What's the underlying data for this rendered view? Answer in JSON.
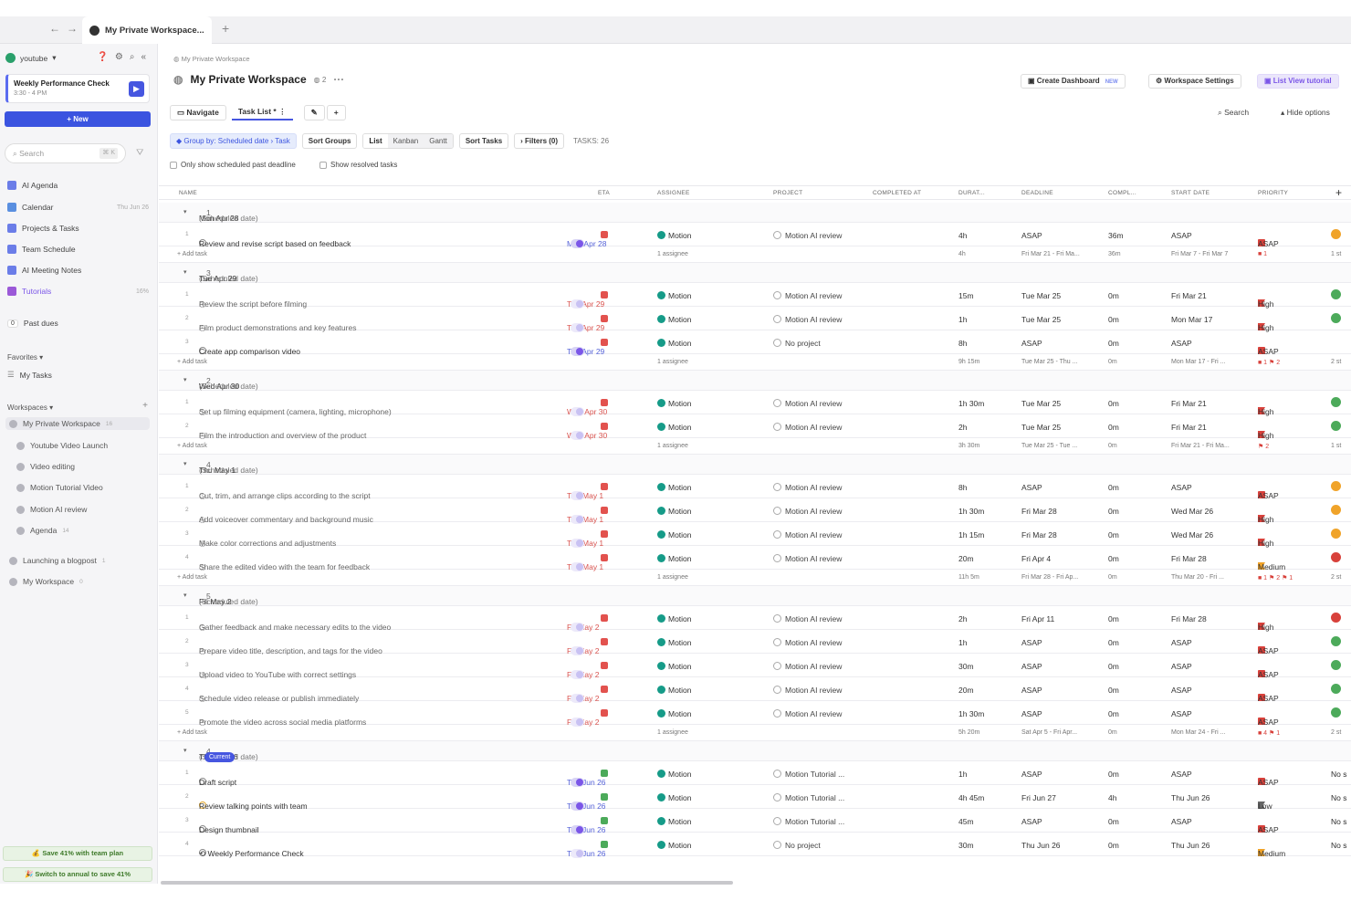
{
  "browser": {
    "tab_title": "My Private Workspace..."
  },
  "sidebar": {
    "workspace_name": "youtube",
    "meeting": {
      "title": "Weekly Performance Check",
      "time": "3:30 - 4 PM"
    },
    "new_label": "New",
    "search_placeholder": "Search",
    "search_shortcut": "⌘ K",
    "nav": [
      {
        "label": "AI Agenda",
        "right": "",
        "color": "#6b7de8"
      },
      {
        "label": "Calendar",
        "right": "Thu Jun 26",
        "color": "#5a8fe0"
      },
      {
        "label": "Projects & Tasks",
        "right": "",
        "color": "#6b7de8"
      },
      {
        "label": "Team Schedule",
        "right": "",
        "color": "#6b7de8"
      },
      {
        "label": "AI Meeting Notes",
        "right": "",
        "color": "#6b7de8"
      },
      {
        "label": "Tutorials",
        "right": "16%",
        "color": "#9b59d8"
      }
    ],
    "past_dues": {
      "count": "0",
      "label": "Past dues"
    },
    "favorites_label": "Favorites",
    "my_tasks": "My Tasks",
    "workspaces_label": "Workspaces",
    "workspaces": [
      {
        "label": "My Private Workspace",
        "count": "16"
      },
      {
        "label": "Youtube Video Launch",
        "count": ""
      },
      {
        "label": "Video editing",
        "count": ""
      },
      {
        "label": "Motion Tutorial Video",
        "count": ""
      },
      {
        "label": "Motion AI review",
        "count": ""
      },
      {
        "label": "Agenda",
        "count": "14"
      }
    ],
    "other_ws": [
      {
        "label": "Launching a blogpost",
        "count": "1"
      },
      {
        "label": "My Workspace",
        "count": "0"
      }
    ],
    "promo1": "💰 Save 41% with team plan",
    "promo2": "🎉 Switch to annual to save 41%"
  },
  "main": {
    "breadcrumb": "My Private Workspace",
    "title": "My Private Workspace",
    "title_count": "2",
    "create_dashboard": "Create Dashboard",
    "new_badge": "NEW",
    "workspace_settings": "Workspace Settings",
    "list_view_tutorial": "List View tutorial",
    "tab_navigate": "Navigate",
    "tab_tasklist": "Task List *",
    "search_label": "Search",
    "hide_options": "Hide options",
    "group_by": "Group by: Scheduled date › Task",
    "sort_groups": "Sort Groups",
    "view_list": "List",
    "view_kanban": "Kanban",
    "view_gantt": "Gantt",
    "sort_tasks": "Sort Tasks",
    "filters": "Filters (0)",
    "tasks_count": "TASKS: 26",
    "chk1": "Only show scheduled past deadline",
    "chk2": "Show resolved tasks",
    "headers": {
      "name": "NAME",
      "eta": "ETA",
      "assignee": "ASSIGNEE",
      "project": "PROJECT",
      "completed": "COMPLETED AT",
      "duration": "DURAT...",
      "deadline": "DEADLINE",
      "compl": "COMPL...",
      "start": "START DATE",
      "priority": "PRIORITY"
    }
  },
  "groups": [
    {
      "label": "Mon Apr 28",
      "sub": "(Scheduled date)",
      "count": "1",
      "current": "",
      "tasks": [
        {
          "idx": "1",
          "name": "Review and revise script based on feedback",
          "icon": "circle",
          "sched": "Mon Apr 28",
          "red": false,
          "toggle": true,
          "eta": "red",
          "assignee": "Motion",
          "project": "Motion AI review",
          "dur": "4h",
          "deadline": "ASAP",
          "compl": "36m",
          "start": "ASAP",
          "pri": "ASAP",
          "pk": "sq",
          "badge": "#f0a329"
        }
      ],
      "add": {
        "assignee": "1 assignee",
        "dur": "4h",
        "deadline": "Fri Mar 21 - Fri Ma...",
        "compl": "36m",
        "start": "Fri Mar 7 - Fri Mar 7",
        "pri": "■ 1",
        "tail": "1 st"
      }
    },
    {
      "label": "Tue Apr 29",
      "sub": "(Scheduled date)",
      "count": "3",
      "current": "",
      "tasks": [
        {
          "idx": "1",
          "name": "Review the script before filming",
          "icon": "clock",
          "sched": "Tue Apr 29",
          "red": true,
          "toggle": false,
          "eta": "red",
          "assignee": "Motion",
          "project": "Motion AI review",
          "dur": "15m",
          "deadline": "Tue Mar 25",
          "compl": "0m",
          "start": "Fri Mar 21",
          "pri": "High",
          "pk": "fl",
          "badge": "#4caa5a"
        },
        {
          "idx": "2",
          "name": "Film product demonstrations and key features",
          "icon": "clock",
          "sched": "Tue Apr 29",
          "red": true,
          "toggle": false,
          "eta": "red",
          "assignee": "Motion",
          "project": "Motion AI review",
          "dur": "1h",
          "deadline": "Tue Mar 25",
          "compl": "0m",
          "start": "Mon Mar 17",
          "pri": "High",
          "pk": "fl",
          "badge": "#4caa5a"
        },
        {
          "idx": "3",
          "name": "Create app comparison video",
          "icon": "circle",
          "sched": "Tue Apr 29",
          "red": false,
          "toggle": true,
          "eta": "red",
          "assignee": "Motion",
          "project": "No project",
          "dur": "8h",
          "deadline": "ASAP",
          "compl": "0m",
          "start": "ASAP",
          "pri": "ASAP",
          "pk": "sq",
          "badge": ""
        }
      ],
      "add": {
        "assignee": "1 assignee",
        "dur": "9h 15m",
        "deadline": "Tue Mar 25 - Thu ...",
        "compl": "0m",
        "start": "Mon Mar 17 - Fri ...",
        "pri": "■ 1  ⚑ 2",
        "tail": "2 st"
      }
    },
    {
      "label": "Wed Apr 30",
      "sub": "(Scheduled date)",
      "count": "2",
      "current": "",
      "tasks": [
        {
          "idx": "1",
          "name": "Set up filming equipment (camera, lighting, microphone)",
          "icon": "clock",
          "sched": "Wed Apr 30",
          "red": true,
          "toggle": false,
          "eta": "red",
          "assignee": "Motion",
          "project": "Motion AI review",
          "dur": "1h 30m",
          "deadline": "Tue Mar 25",
          "compl": "0m",
          "start": "Fri Mar 21",
          "pri": "High",
          "pk": "fl",
          "badge": "#4caa5a"
        },
        {
          "idx": "2",
          "name": "Film the introduction and overview of the product",
          "icon": "clock",
          "sched": "Wed Apr 30",
          "red": true,
          "toggle": false,
          "eta": "red",
          "assignee": "Motion",
          "project": "Motion AI review",
          "dur": "2h",
          "deadline": "Tue Mar 25",
          "compl": "0m",
          "start": "Fri Mar 21",
          "pri": "High",
          "pk": "fl",
          "badge": "#4caa5a"
        }
      ],
      "add": {
        "assignee": "1 assignee",
        "dur": "3h 30m",
        "deadline": "Tue Mar 25 - Tue ...",
        "compl": "0m",
        "start": "Fri Mar 21 - Fri Ma...",
        "pri": "⚑ 2",
        "tail": "1 st"
      }
    },
    {
      "label": "Thu May 1",
      "sub": "(Scheduled date)",
      "count": "4",
      "current": "",
      "tasks": [
        {
          "idx": "1",
          "name": "Cut, trim, and arrange clips according to the script",
          "icon": "clock",
          "sched": "Thu May 1",
          "red": true,
          "toggle": false,
          "eta": "red",
          "assignee": "Motion",
          "project": "Motion AI review",
          "dur": "8h",
          "deadline": "ASAP",
          "compl": "0m",
          "start": "ASAP",
          "pri": "ASAP",
          "pk": "sq",
          "badge": "#f0a329"
        },
        {
          "idx": "2",
          "name": "Add voiceover commentary and background music",
          "icon": "clock",
          "sched": "Thu May 1",
          "red": true,
          "toggle": false,
          "eta": "red",
          "assignee": "Motion",
          "project": "Motion AI review",
          "dur": "1h 30m",
          "deadline": "Fri Mar 28",
          "compl": "0m",
          "start": "Wed Mar 26",
          "pri": "High",
          "pk": "fl",
          "badge": "#f0a329"
        },
        {
          "idx": "3",
          "name": "Make color corrections and adjustments",
          "icon": "clock",
          "sched": "Thu May 1",
          "red": true,
          "toggle": false,
          "eta": "red",
          "assignee": "Motion",
          "project": "Motion AI review",
          "dur": "1h 15m",
          "deadline": "Fri Mar 28",
          "compl": "0m",
          "start": "Wed Mar 26",
          "pri": "High",
          "pk": "fl",
          "badge": "#f0a329"
        },
        {
          "idx": "4",
          "name": "Share the edited video with the team for feedback",
          "icon": "clock",
          "sched": "Thu May 1",
          "red": true,
          "toggle": false,
          "eta": "red",
          "assignee": "Motion",
          "project": "Motion AI review",
          "dur": "20m",
          "deadline": "Fri Apr 4",
          "compl": "0m",
          "start": "Fri Mar 28",
          "pri": "Medium",
          "pk": "flo",
          "badge": "#d8413b"
        }
      ],
      "add": {
        "assignee": "1 assignee",
        "dur": "11h 5m",
        "deadline": "Fri Mar 28 - Fri Ap...",
        "compl": "0m",
        "start": "Thu Mar 20 - Fri ...",
        "pri": "■ 1  ⚑ 2  ⚑ 1",
        "tail": "2 st"
      }
    },
    {
      "label": "Fri May 2",
      "sub": "(Scheduled date)",
      "count": "5",
      "current": "",
      "tasks": [
        {
          "idx": "1",
          "name": "Gather feedback and make necessary edits to the video",
          "icon": "clock",
          "sched": "Fri May 2",
          "red": true,
          "toggle": false,
          "eta": "red",
          "assignee": "Motion",
          "project": "Motion AI review",
          "dur": "2h",
          "deadline": "Fri Apr 11",
          "compl": "0m",
          "start": "Fri Mar 28",
          "pri": "High",
          "pk": "fl",
          "badge": "#d8413b"
        },
        {
          "idx": "2",
          "name": "Prepare video title, description, and tags for the video",
          "icon": "clock",
          "sched": "Fri May 2",
          "red": true,
          "toggle": false,
          "eta": "red",
          "assignee": "Motion",
          "project": "Motion AI review",
          "dur": "1h",
          "deadline": "ASAP",
          "compl": "0m",
          "start": "ASAP",
          "pri": "ASAP",
          "pk": "sq",
          "badge": "#4caa5a"
        },
        {
          "idx": "3",
          "name": "Upload video to YouTube with correct settings",
          "icon": "clock",
          "sched": "Fri May 2",
          "red": true,
          "toggle": false,
          "eta": "red",
          "assignee": "Motion",
          "project": "Motion AI review",
          "dur": "30m",
          "deadline": "ASAP",
          "compl": "0m",
          "start": "ASAP",
          "pri": "ASAP",
          "pk": "sq",
          "badge": "#4caa5a"
        },
        {
          "idx": "4",
          "name": "Schedule video release or publish immediately",
          "icon": "clock",
          "sched": "Fri May 2",
          "red": true,
          "toggle": false,
          "eta": "red",
          "assignee": "Motion",
          "project": "Motion AI review",
          "dur": "20m",
          "deadline": "ASAP",
          "compl": "0m",
          "start": "ASAP",
          "pri": "ASAP",
          "pk": "sq",
          "badge": "#4caa5a"
        },
        {
          "idx": "5",
          "name": "Promote the video across social media platforms",
          "icon": "clock",
          "sched": "Fri May 2",
          "red": true,
          "toggle": false,
          "eta": "red",
          "assignee": "Motion",
          "project": "Motion AI review",
          "dur": "1h 30m",
          "deadline": "ASAP",
          "compl": "0m",
          "start": "ASAP",
          "pri": "ASAP",
          "pk": "sq",
          "badge": "#4caa5a"
        }
      ],
      "add": {
        "assignee": "1 assignee",
        "dur": "5h 20m",
        "deadline": "Sat Apr 5 - Fri Apr...",
        "compl": "0m",
        "start": "Mon Mar 24 - Fri ...",
        "pri": "■ 4  ⚑ 1",
        "tail": "2 st"
      }
    },
    {
      "label": "Thu Jun 26",
      "sub": "(Scheduled date)",
      "count": "4",
      "current": "Current",
      "tasks": [
        {
          "idx": "1",
          "name": "Draft script",
          "icon": "circle",
          "sched": "Thu Jun 26",
          "red": false,
          "toggle": true,
          "eta": "green",
          "assignee": "Motion",
          "project": "Motion Tutorial ...",
          "dur": "1h",
          "deadline": "ASAP",
          "compl": "0m",
          "start": "ASAP",
          "pri": "ASAP",
          "pk": "sq",
          "badge": "",
          "tail": "No s"
        },
        {
          "idx": "2",
          "name": "Review talking points with team",
          "icon": "ycircle",
          "sched": "Thu Jun 26",
          "red": false,
          "toggle": true,
          "eta": "green",
          "assignee": "Motion",
          "project": "Motion Tutorial ...",
          "dur": "4h 45m",
          "deadline": "Fri Jun 27",
          "compl": "4h",
          "start": "Thu Jun 26",
          "pri": "Low",
          "pk": "flg",
          "badge": "",
          "tail": "No s"
        },
        {
          "idx": "3",
          "name": "Design thumbnail",
          "icon": "circle",
          "sched": "Thu Jun 26",
          "red": false,
          "toggle": true,
          "eta": "green",
          "assignee": "Motion",
          "project": "Motion Tutorial ...",
          "dur": "45m",
          "deadline": "ASAP",
          "compl": "0m",
          "start": "ASAP",
          "pri": "ASAP",
          "pk": "sq",
          "badge": "",
          "tail": "No s"
        },
        {
          "idx": "4",
          "name": "⟲ Weekly Performance Check",
          "icon": "circle",
          "sched": "Thu Jun 26",
          "red": false,
          "toggle": false,
          "eta": "green",
          "assignee": "Motion",
          "project": "No project",
          "dur": "30m",
          "deadline": "Thu Jun 26",
          "compl": "0m",
          "start": "Thu Jun 26",
          "pri": "Medium",
          "pk": "flo",
          "badge": "",
          "tail": "No s"
        }
      ],
      "add": null
    }
  ],
  "add_task_label": "+ Add task"
}
